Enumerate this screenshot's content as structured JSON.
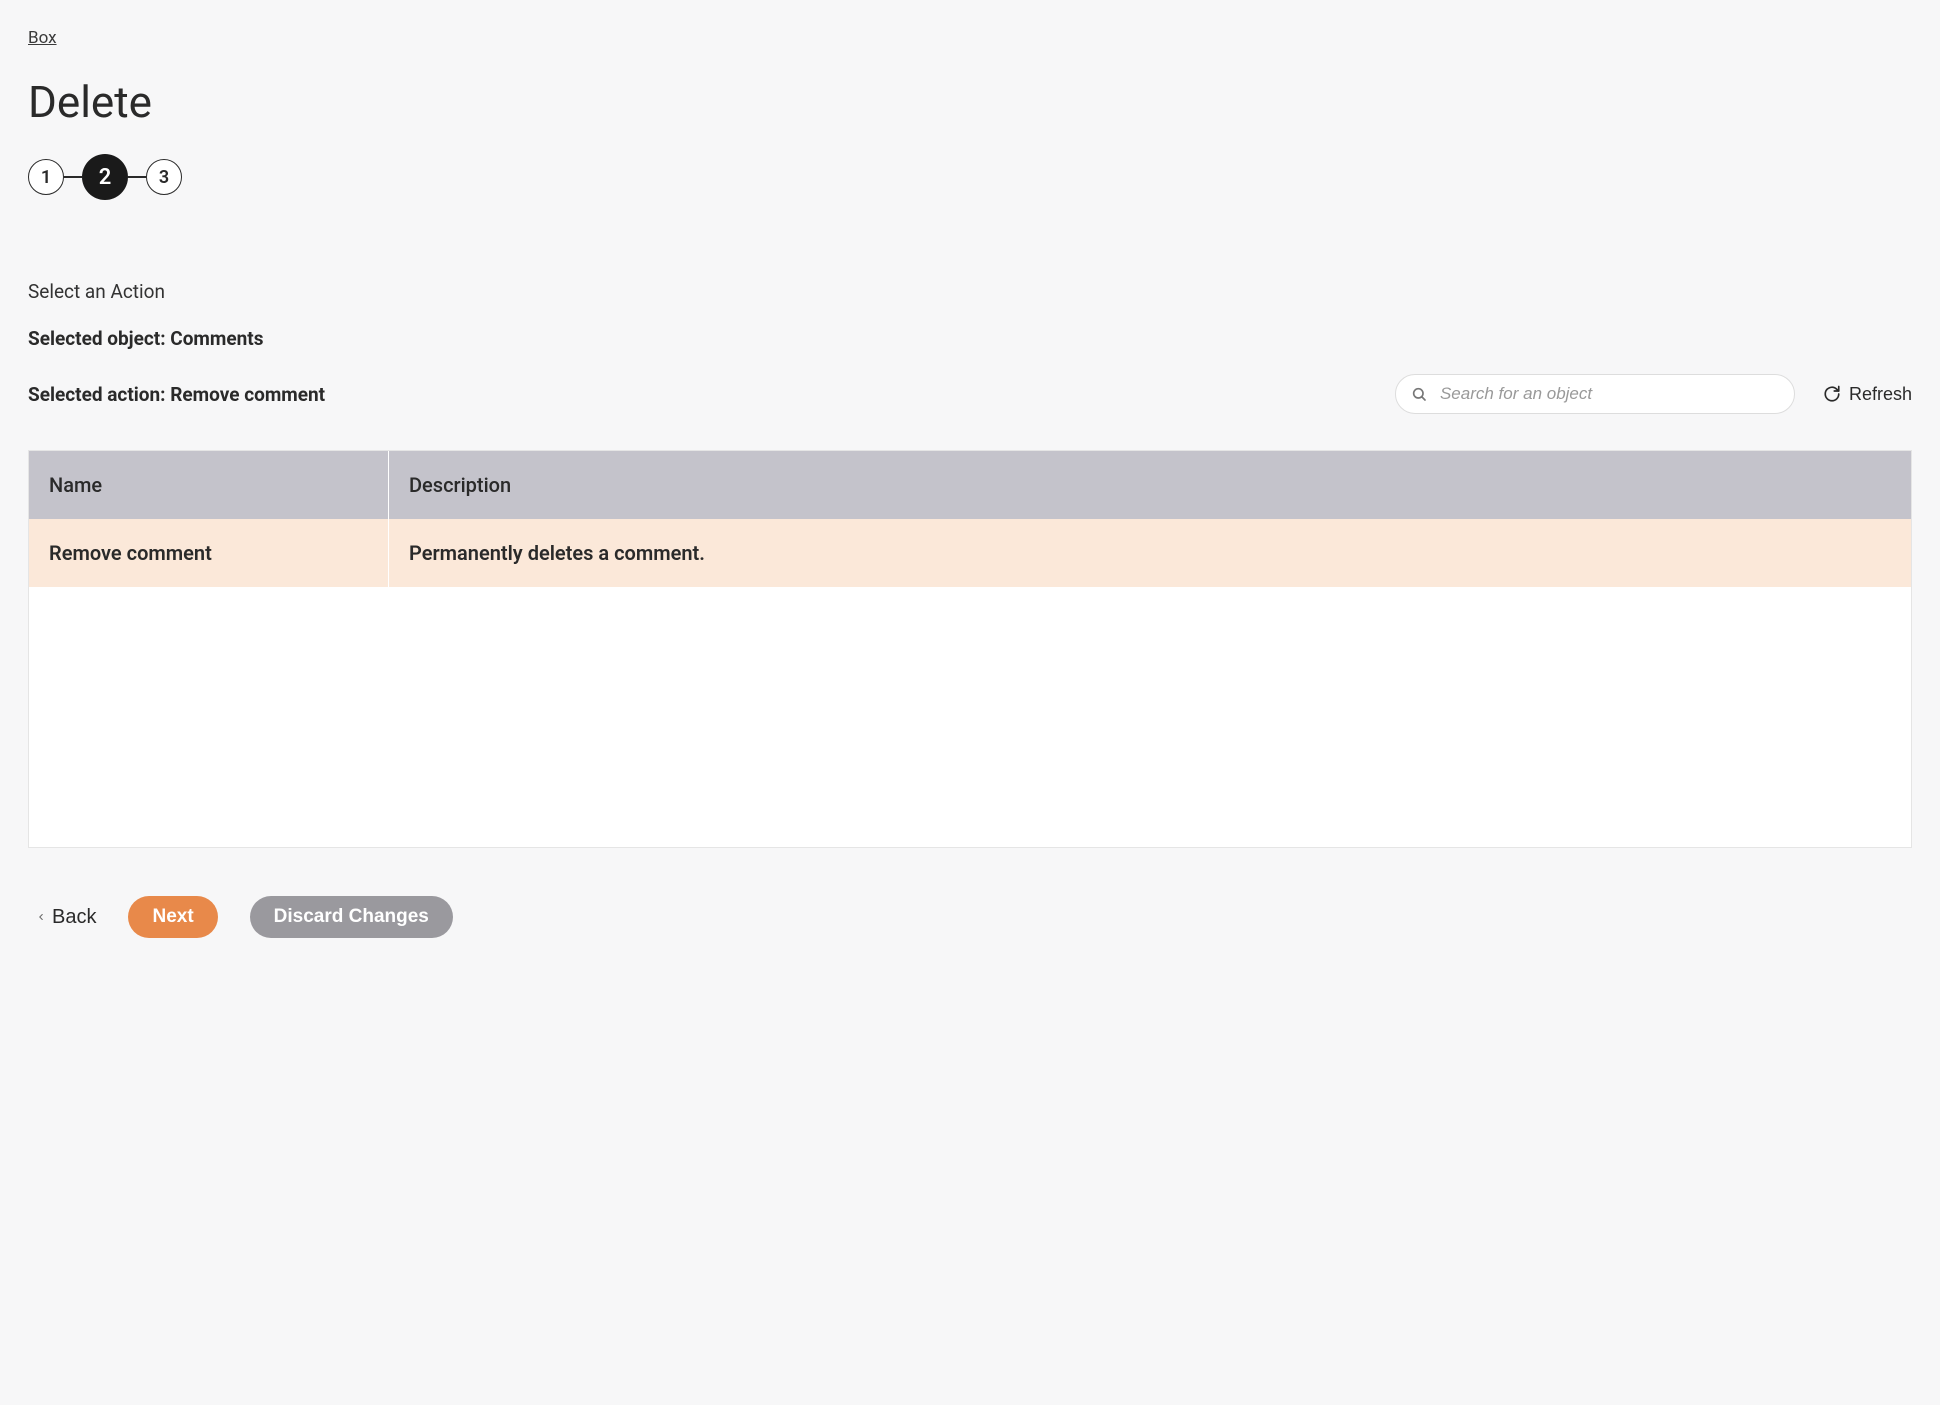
{
  "breadcrumb": {
    "label": "Box"
  },
  "page": {
    "title": "Delete"
  },
  "stepper": {
    "steps": [
      "1",
      "2",
      "3"
    ],
    "activeIndex": 1
  },
  "section": {
    "subheading": "Select an Action",
    "selectedObjectLine": "Selected object: Comments",
    "selectedActionLine": "Selected action: Remove comment"
  },
  "search": {
    "placeholder": "Search for an object"
  },
  "refresh": {
    "label": "Refresh"
  },
  "table": {
    "headers": {
      "name": "Name",
      "description": "Description"
    },
    "rows": [
      {
        "name": "Remove comment",
        "description": "Permanently deletes a comment."
      }
    ]
  },
  "footer": {
    "back": "Back",
    "next": "Next",
    "discard": "Discard Changes"
  }
}
